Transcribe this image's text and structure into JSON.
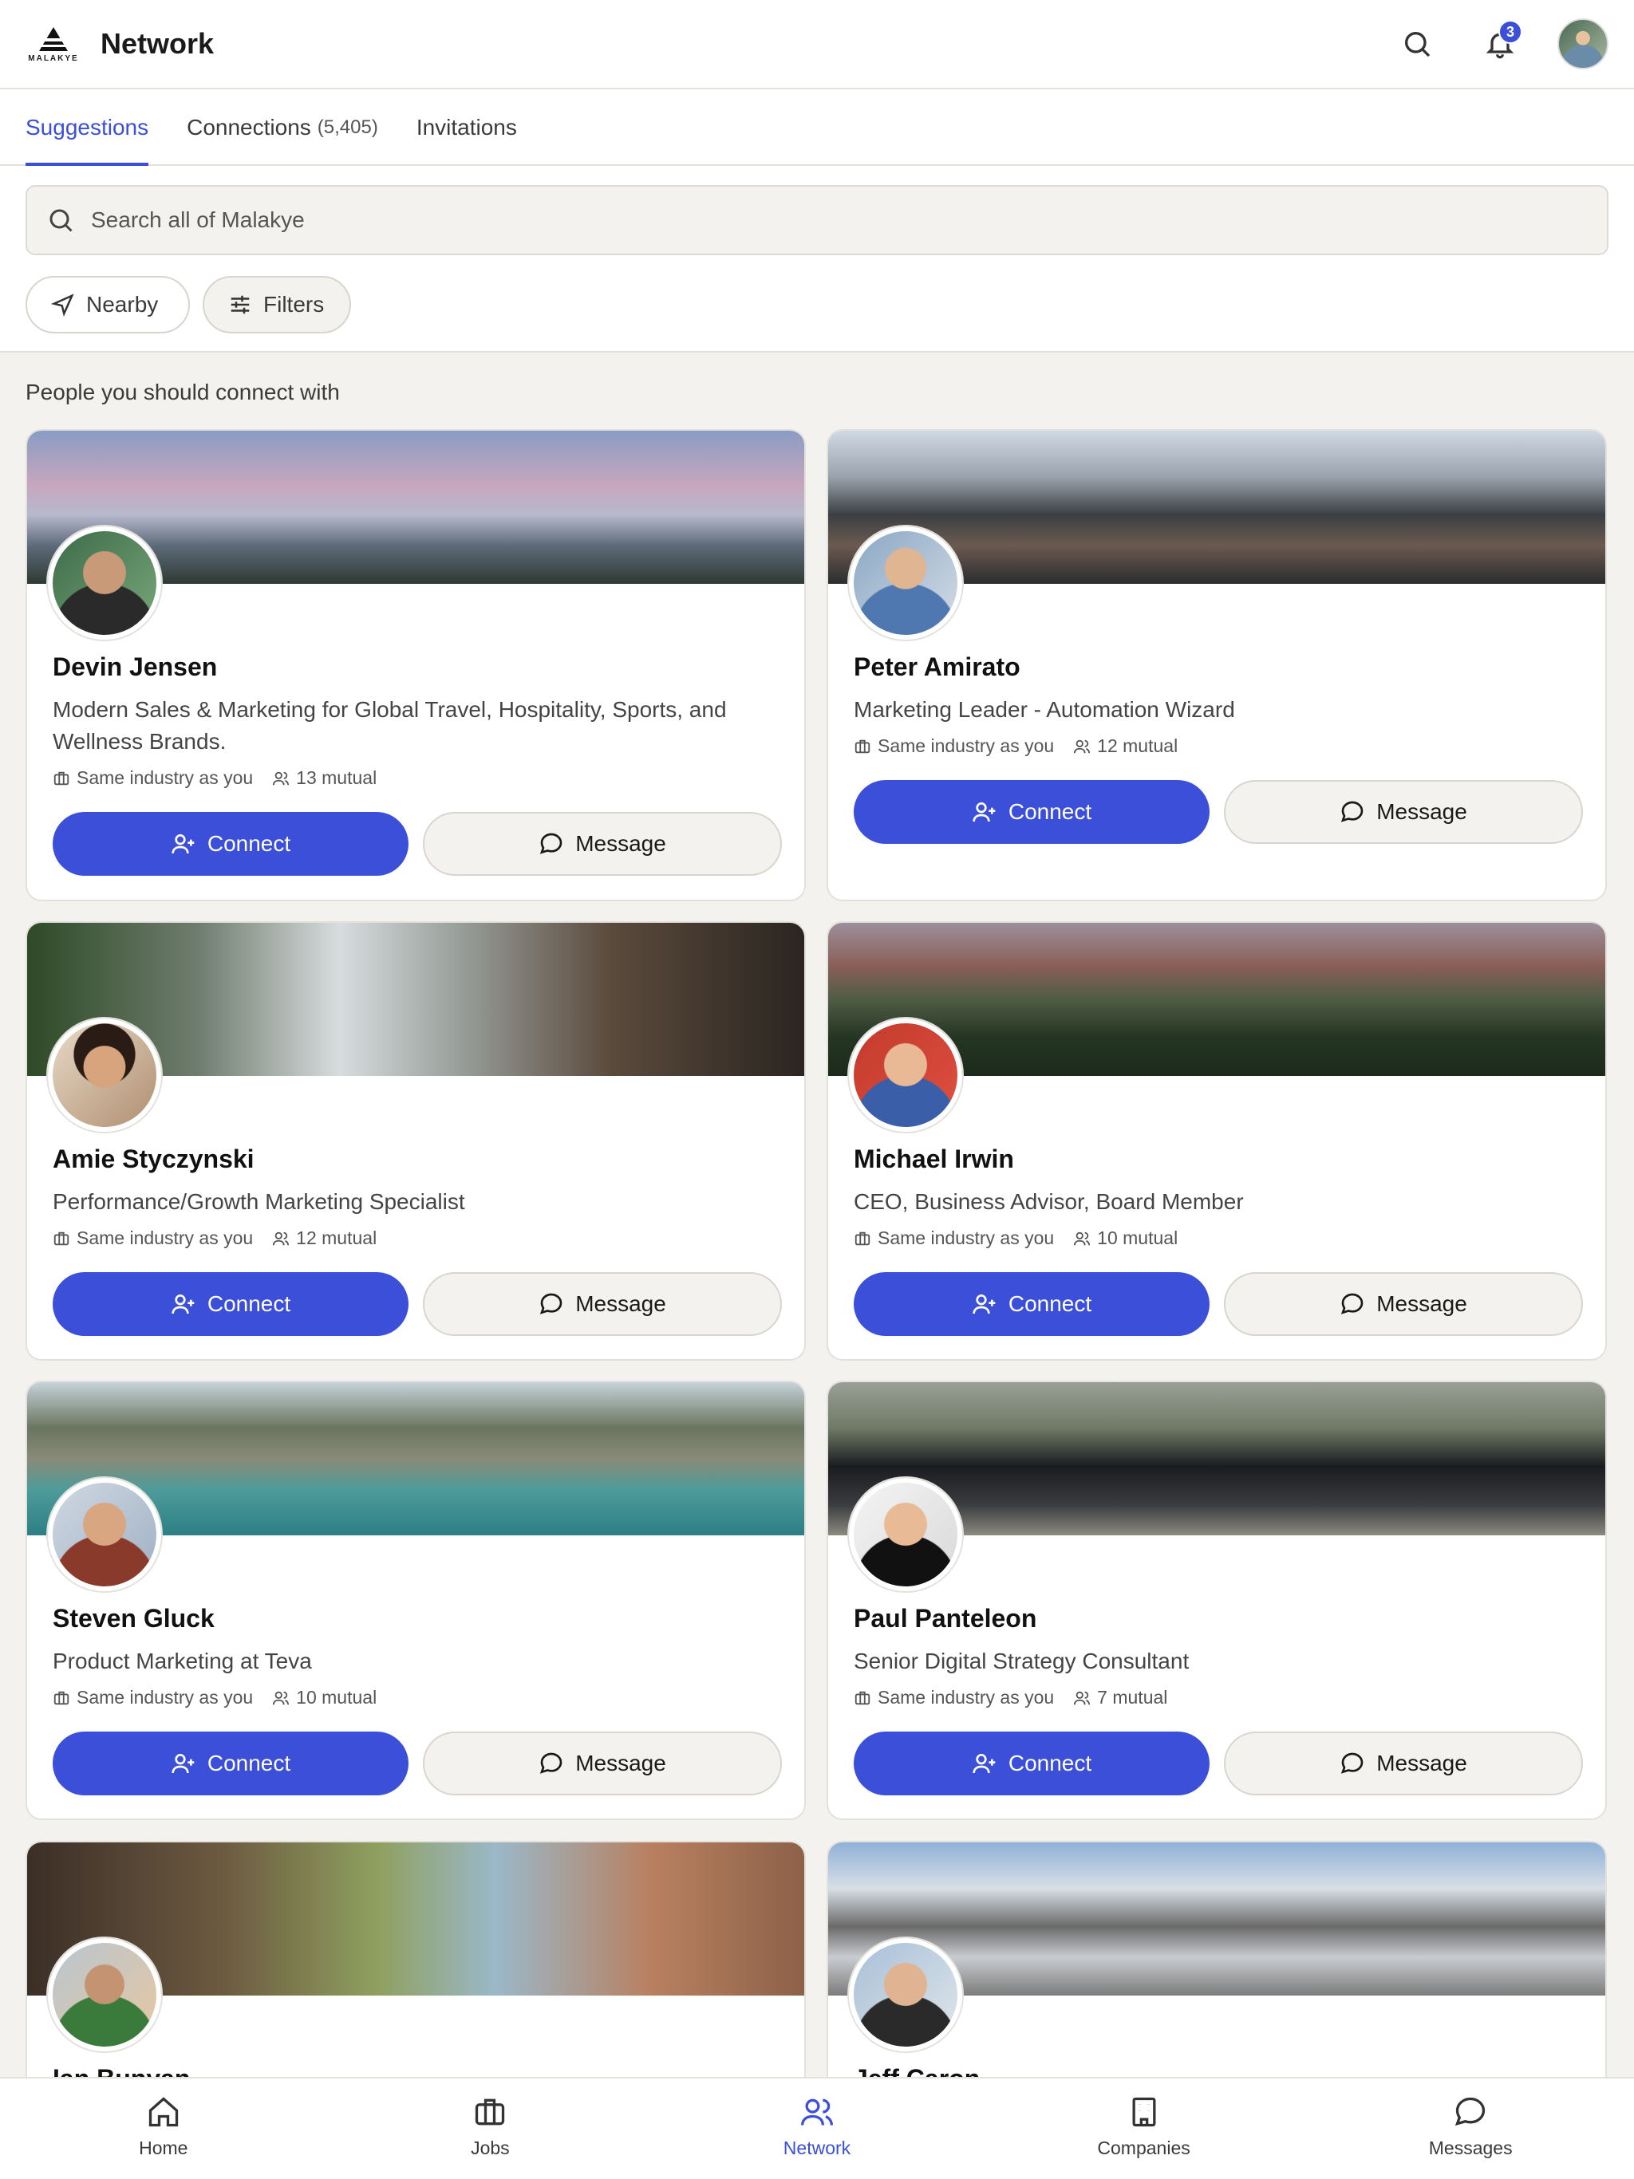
{
  "header": {
    "logo_text": "MALAKYE",
    "title": "Network",
    "notification_count": "3"
  },
  "tabs": [
    {
      "label": "Suggestions",
      "count": ""
    },
    {
      "label": "Connections",
      "count": "(5,405)"
    },
    {
      "label": "Invitations",
      "count": ""
    }
  ],
  "search": {
    "placeholder": "Search all of Malakye"
  },
  "chips": {
    "nearby": "Nearby",
    "filters": "Filters"
  },
  "section_title": "People you should connect with",
  "labels": {
    "same_industry": "Same industry as you",
    "connect": "Connect",
    "message": "Message"
  },
  "people": [
    {
      "name": "Devin Jensen",
      "title": "Modern Sales & Marketing for Global Travel, Hospitality, Sports, and Wellness Brands.",
      "mutual": "13 mutual",
      "banner": "mountain-sunset"
    },
    {
      "name": "Peter Amirato",
      "title": "Marketing Leader - Automation Wizard",
      "mutual": "12 mutual",
      "banner": "event-crowd"
    },
    {
      "name": "Amie Styczynski",
      "title": "Performance/Growth Marketing Specialist",
      "mutual": "12 mutual",
      "banner": "waterfall"
    },
    {
      "name": "Michael Irwin",
      "title": "CEO, Business Advisor, Board Member",
      "mutual": "10 mutual",
      "banner": "forest"
    },
    {
      "name": "Steven Gluck",
      "title": "Product Marketing at Teva",
      "mutual": "10 mutual",
      "banner": "bay-cliffs"
    },
    {
      "name": "Paul Panteleon",
      "title": "Senior Digital Strategy Consultant",
      "mutual": "7 mutual",
      "banner": "sports-car"
    },
    {
      "name": "Ian Bunyan",
      "banner": "mountain-bike"
    },
    {
      "name": "Jeff Caron",
      "banner": "rock-cairns"
    }
  ],
  "nav": [
    {
      "label": "Home",
      "icon": "home-icon"
    },
    {
      "label": "Jobs",
      "icon": "briefcase-icon"
    },
    {
      "label": "Network",
      "icon": "users-icon"
    },
    {
      "label": "Companies",
      "icon": "building-icon"
    },
    {
      "label": "Messages",
      "icon": "chat-icon"
    }
  ],
  "colors": {
    "accent": "#3b4fd8",
    "background": "#f4f2ee",
    "card": "#ffffff"
  }
}
